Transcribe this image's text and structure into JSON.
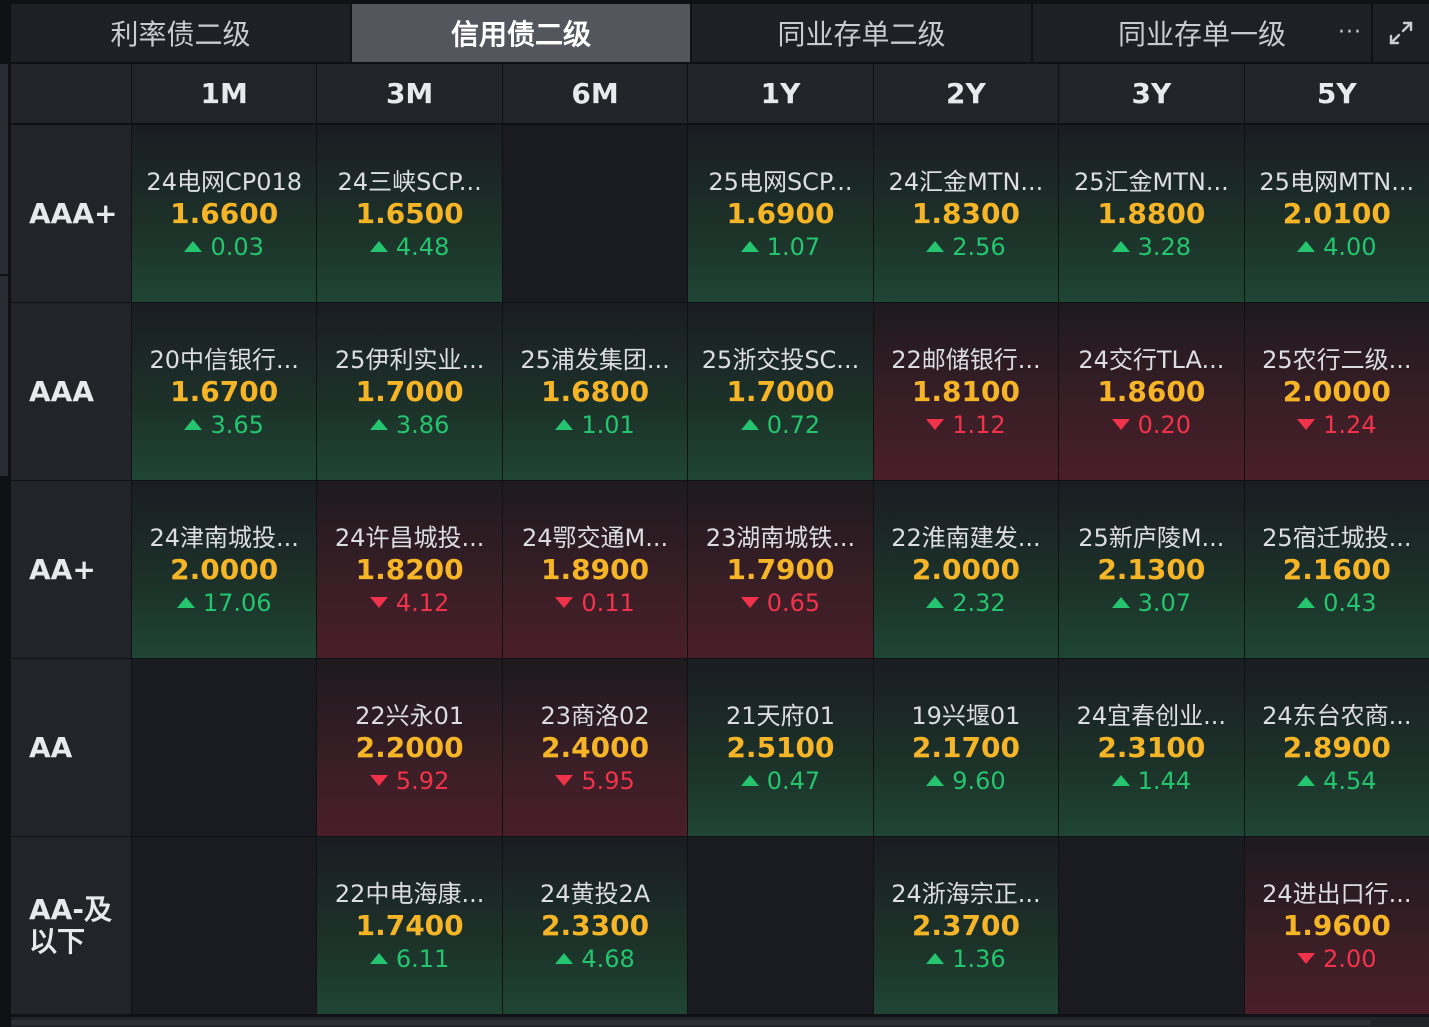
{
  "tabs": [
    {
      "label": "利率债二级",
      "active": false
    },
    {
      "label": "信用债二级",
      "active": true
    },
    {
      "label": "同业存单二级",
      "active": false
    },
    {
      "label": "同业存单一级",
      "active": false
    }
  ],
  "more_label": "···",
  "icons": {
    "more": "more-dots-icon",
    "expand": "expand-icon"
  },
  "colors": {
    "yield": "#f5b526",
    "up": "#25c46e",
    "down": "#f0334a",
    "active_tab": "#54565d"
  },
  "columns": [
    "1M",
    "3M",
    "6M",
    "1Y",
    "2Y",
    "3Y",
    "5Y"
  ],
  "rows": [
    {
      "label": "AAA+",
      "cells": [
        {
          "name": "24电网CP018",
          "yield": "1.6600",
          "change": "0.03",
          "dir": "up"
        },
        {
          "name": "24三峡SCP...",
          "yield": "1.6500",
          "change": "4.48",
          "dir": "up"
        },
        null,
        {
          "name": "25电网SCP...",
          "yield": "1.6900",
          "change": "1.07",
          "dir": "up"
        },
        {
          "name": "24汇金MTN...",
          "yield": "1.8300",
          "change": "2.56",
          "dir": "up"
        },
        {
          "name": "25汇金MTN...",
          "yield": "1.8800",
          "change": "3.28",
          "dir": "up"
        },
        {
          "name": "25电网MTN...",
          "yield": "2.0100",
          "change": "4.00",
          "dir": "up"
        }
      ]
    },
    {
      "label": "AAA",
      "cells": [
        {
          "name": "20中信银行...",
          "yield": "1.6700",
          "change": "3.65",
          "dir": "up"
        },
        {
          "name": "25伊利实业...",
          "yield": "1.7000",
          "change": "3.86",
          "dir": "up"
        },
        {
          "name": "25浦发集团...",
          "yield": "1.6800",
          "change": "1.01",
          "dir": "up"
        },
        {
          "name": "25浙交投SC...",
          "yield": "1.7000",
          "change": "0.72",
          "dir": "up"
        },
        {
          "name": "22邮储银行...",
          "yield": "1.8100",
          "change": "1.12",
          "dir": "down"
        },
        {
          "name": "24交行TLA...",
          "yield": "1.8600",
          "change": "0.20",
          "dir": "down"
        },
        {
          "name": "25农行二级...",
          "yield": "2.0000",
          "change": "1.24",
          "dir": "down"
        }
      ]
    },
    {
      "label": "AA+",
      "cells": [
        {
          "name": "24津南城投...",
          "yield": "2.0000",
          "change": "17.06",
          "dir": "up"
        },
        {
          "name": "24许昌城投...",
          "yield": "1.8200",
          "change": "4.12",
          "dir": "down"
        },
        {
          "name": "24鄂交通M...",
          "yield": "1.8900",
          "change": "0.11",
          "dir": "down"
        },
        {
          "name": "23湖南城铁...",
          "yield": "1.7900",
          "change": "0.65",
          "dir": "down"
        },
        {
          "name": "22淮南建发...",
          "yield": "2.0000",
          "change": "2.32",
          "dir": "up"
        },
        {
          "name": "25新庐陵M...",
          "yield": "2.1300",
          "change": "3.07",
          "dir": "up"
        },
        {
          "name": "25宿迁城投...",
          "yield": "2.1600",
          "change": "0.43",
          "dir": "up"
        }
      ]
    },
    {
      "label": "AA",
      "cells": [
        null,
        {
          "name": "22兴永01",
          "yield": "2.2000",
          "change": "5.92",
          "dir": "down"
        },
        {
          "name": "23商洛02",
          "yield": "2.4000",
          "change": "5.95",
          "dir": "down"
        },
        {
          "name": "21天府01",
          "yield": "2.5100",
          "change": "0.47",
          "dir": "up"
        },
        {
          "name": "19兴堰01",
          "yield": "2.1700",
          "change": "9.60",
          "dir": "up"
        },
        {
          "name": "24宜春创业...",
          "yield": "2.3100",
          "change": "1.44",
          "dir": "up"
        },
        {
          "name": "24东台农商...",
          "yield": "2.8900",
          "change": "4.54",
          "dir": "up"
        }
      ]
    },
    {
      "label_lines": [
        "AA-及",
        "以下"
      ],
      "cells": [
        null,
        {
          "name": "22中电海康...",
          "yield": "1.7400",
          "change": "6.11",
          "dir": "up"
        },
        {
          "name": "24黄投2A",
          "yield": "2.3300",
          "change": "4.68",
          "dir": "up"
        },
        null,
        {
          "name": "24浙海宗正...",
          "yield": "2.3700",
          "change": "1.36",
          "dir": "up"
        },
        null,
        {
          "name": "24进出口行...",
          "yield": "1.9600",
          "change": "2.00",
          "dir": "down"
        }
      ]
    }
  ]
}
